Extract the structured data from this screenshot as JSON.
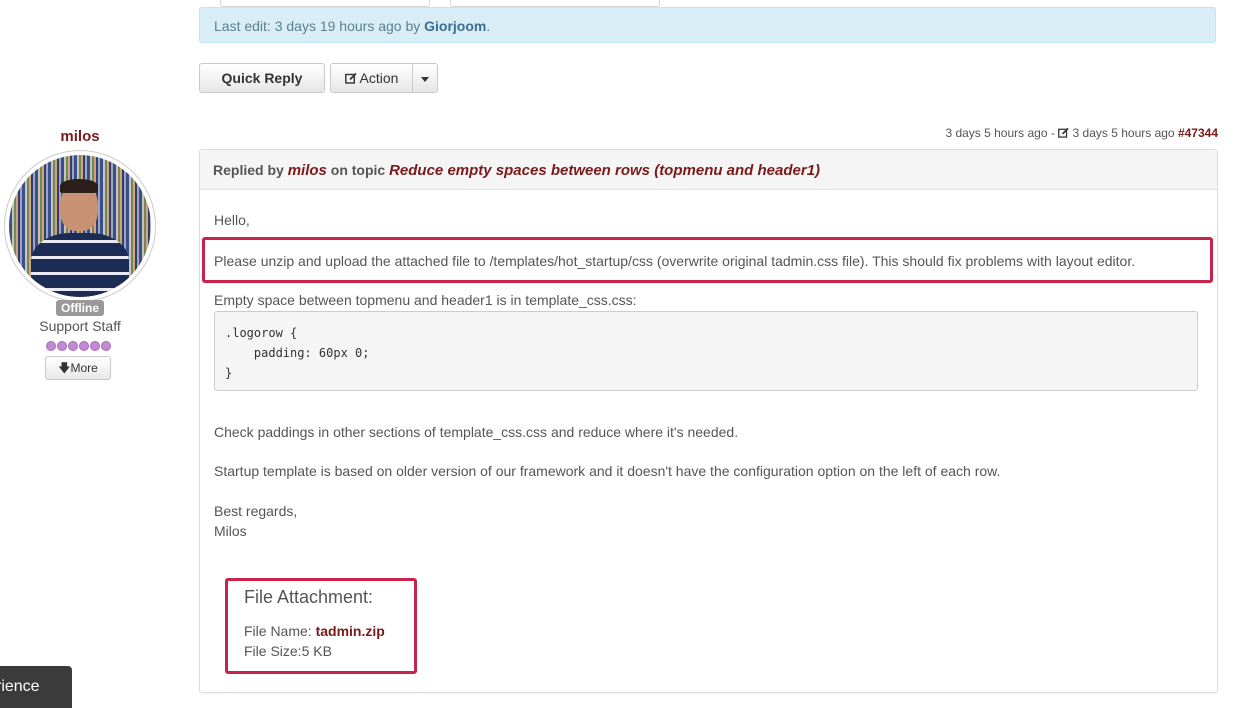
{
  "edit_notice": {
    "prefix": "Last edit: 3 days 19 hours ago by ",
    "editor": "Giorjoom",
    "suffix": "."
  },
  "buttons": {
    "quick_reply": "Quick Reply",
    "action": "Action",
    "action_icon": "edit-icon",
    "dropdown_icon": "caret-down-icon"
  },
  "user": {
    "name": "milos",
    "status": "Offline",
    "role": "Support Staff",
    "rank_stars": 6,
    "more_label": "More",
    "more_icon": "arrow-down-icon"
  },
  "post_meta": {
    "created": "3 days 5 hours ago",
    "separator": " - ",
    "edited": "3 days 5 hours ago",
    "edit_icon": "edit-icon",
    "post_id": "#47344"
  },
  "post": {
    "head_prefix": "Replied by ",
    "author": "milos",
    "head_mid": " on topic ",
    "topic": "Reduce empty spaces between rows (topmenu and header1)",
    "greeting": "Hello,",
    "instruction": "Please unzip and upload the attached file to /templates/hot_startup/css (overwrite original tadmin.css file). This should fix problems with layout editor.",
    "space_note": "Empty space between topmenu and header1 is in template_css.css:",
    "code": ".logorow {\n    padding: 60px 0;\n}",
    "paddings": "Check paddings in other sections of template_css.css and reduce where it's needed.",
    "framework": "Startup template is based on older version of our framework and it doesn't have the configuration option on the left of each row.",
    "regards": "Best regards,",
    "signature": "Milos"
  },
  "attachment": {
    "title": "File Attachment:",
    "name_label": "File Name: ",
    "name": "tadmin.zip",
    "size_label": "File Size:",
    "size": "5 KB"
  },
  "cookie_bar": {
    "text": "rience"
  },
  "colors": {
    "accent": "#7a1a1a",
    "highlight_border": "#c8234a",
    "info_bg": "#d9edf7"
  }
}
